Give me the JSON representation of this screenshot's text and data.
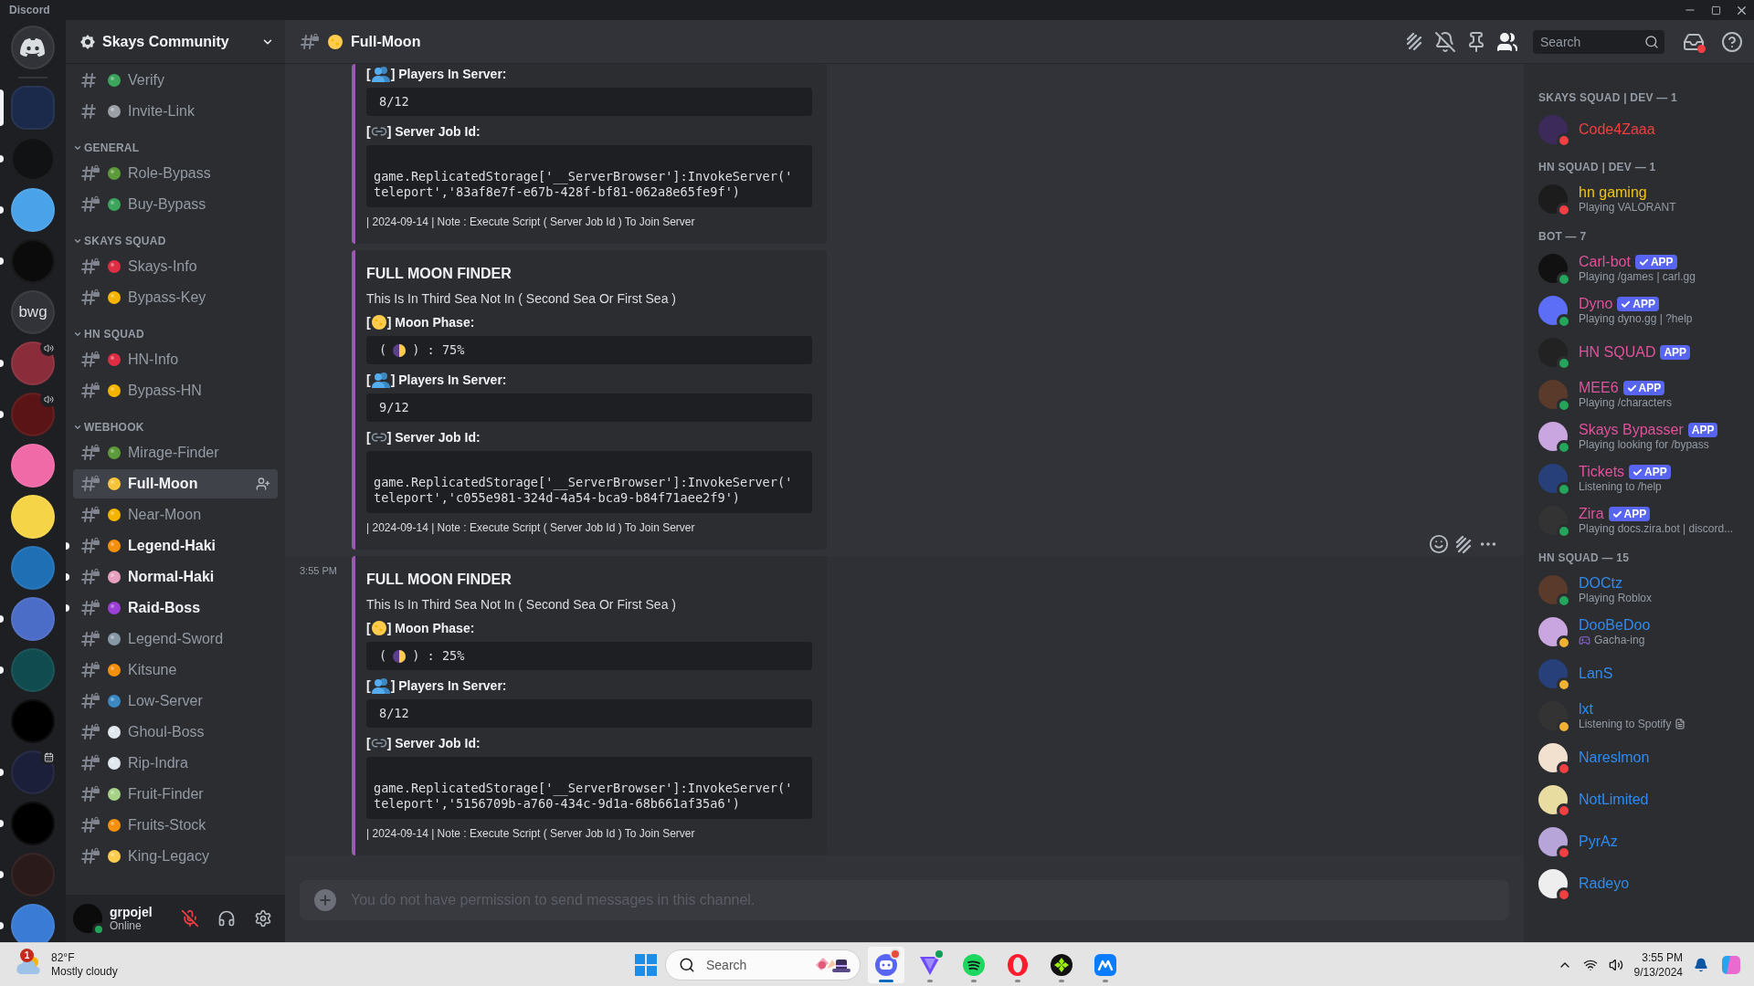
{
  "app_title": "Discord",
  "servers": [
    {
      "kind": "home",
      "selected": false,
      "unread": false
    },
    {
      "kind": "icon",
      "selected": true
    },
    {
      "kind": "icon",
      "selected": false,
      "unread": true
    },
    {
      "kind": "icon",
      "selected": false,
      "unread": true
    },
    {
      "kind": "icon",
      "selected": false,
      "unread": true
    },
    {
      "kind": "text",
      "label": "bwg",
      "selected": false,
      "unread": false
    },
    {
      "kind": "icon",
      "selected": false,
      "unread": true,
      "voice_active": true
    },
    {
      "kind": "icon",
      "selected": false,
      "unread": true,
      "voice_active": true
    },
    {
      "kind": "icon",
      "selected": false,
      "unread": false
    },
    {
      "kind": "icon",
      "selected": false,
      "unread": false
    },
    {
      "kind": "icon",
      "selected": false,
      "unread": false
    },
    {
      "kind": "icon",
      "selected": false,
      "unread": true
    },
    {
      "kind": "icon",
      "selected": false,
      "unread": true
    },
    {
      "kind": "icon",
      "selected": false,
      "unread": false
    },
    {
      "kind": "icon",
      "selected": false,
      "unread": true,
      "has_event": true
    },
    {
      "kind": "icon",
      "selected": false,
      "unread": true
    },
    {
      "kind": "icon",
      "selected": false,
      "unread": true
    },
    {
      "kind": "icon",
      "selected": false,
      "unread": true
    }
  ],
  "channel_sidebar": {
    "server_name": "Skays Community",
    "groups": [
      {
        "channels": [
          {
            "name": "Verify",
            "locked": false,
            "selected": false,
            "unread": false
          },
          {
            "name": "Invite-Link",
            "locked": false,
            "selected": false,
            "unread": false
          }
        ]
      },
      {
        "category": "GENERAL",
        "expanded": true,
        "channels": [
          {
            "name": "Role-Bypass",
            "locked": true,
            "selected": false,
            "unread": false
          },
          {
            "name": "Buy-Bypass",
            "locked": true,
            "selected": false,
            "unread": false
          }
        ]
      },
      {
        "category": "SKAYS SQUAD",
        "expanded": true,
        "channels": [
          {
            "name": "Skays-Info",
            "locked": true,
            "selected": false,
            "unread": false
          },
          {
            "name": "Bypass-Key",
            "locked": true,
            "selected": false,
            "unread": false
          }
        ]
      },
      {
        "category": "HN SQUAD",
        "expanded": true,
        "channels": [
          {
            "name": "HN-Info",
            "locked": true,
            "selected": false,
            "unread": false
          },
          {
            "name": "Bypass-HN",
            "locked": true,
            "selected": false,
            "unread": false
          }
        ]
      },
      {
        "category": "WEBHOOK",
        "expanded": true,
        "channels": [
          {
            "name": "Mirage-Finder",
            "locked": true,
            "selected": false,
            "unread": false
          },
          {
            "name": "Full-Moon",
            "locked": true,
            "selected": true,
            "unread": false
          },
          {
            "name": "Near-Moon",
            "locked": true,
            "selected": false,
            "unread": false
          },
          {
            "name": "Legend-Haki",
            "locked": true,
            "selected": false,
            "unread": true
          },
          {
            "name": "Normal-Haki",
            "locked": true,
            "selected": false,
            "unread": true
          },
          {
            "name": "Raid-Boss",
            "locked": true,
            "selected": false,
            "unread": true
          },
          {
            "name": "Legend-Sword",
            "locked": true,
            "selected": false,
            "unread": false
          },
          {
            "name": "Kitsune",
            "locked": true,
            "selected": false,
            "unread": false
          },
          {
            "name": "Low-Server",
            "locked": true,
            "selected": false,
            "unread": false
          },
          {
            "name": "Ghoul-Boss",
            "locked": true,
            "selected": false,
            "unread": false
          },
          {
            "name": "Rip-Indra",
            "locked": true,
            "selected": false,
            "unread": false
          },
          {
            "name": "Fruit-Finder",
            "locked": true,
            "selected": false,
            "unread": false
          },
          {
            "name": "Fruits-Stock",
            "locked": true,
            "selected": false,
            "unread": false
          },
          {
            "name": "King-Legacy",
            "locked": true,
            "selected": false,
            "unread": false
          }
        ]
      }
    ]
  },
  "user_panel": {
    "username": "grpojel",
    "status_text": "Online",
    "muted": true
  },
  "channel_header": {
    "name": "Full-Moon",
    "search_placeholder": "Search",
    "member_list_shown": true
  },
  "messages": [
    {
      "embed": {
        "fields": [
          {
            "kind": "players",
            "open": "[",
            "label": "] Players In Server:",
            "value": "8/12"
          },
          {
            "kind": "link",
            "open": "[",
            "label": "] Server Job Id:",
            "code": "game.ReplicatedStorage['__ServerBrowser']:InvokeServer('teleport','83af8e7f-e67b-428f-bf81-062a8e65fe9f')"
          }
        ],
        "footer": "| 2024-09-14 | Note : Execute Script ( Server Job Id ) To Join Server"
      }
    },
    {
      "embed": {
        "title": "FULL MOON FINDER",
        "description": "This Is In Third Sea Not In ( Second Sea Or First Sea )",
        "fields": [
          {
            "kind": "moon",
            "open": "[",
            "label": "] Moon Phase:",
            "value_open": "(",
            "value": ") : 75%"
          },
          {
            "kind": "players",
            "open": "[",
            "label": "] Players In Server:",
            "value": "9/12"
          },
          {
            "kind": "link",
            "open": "[",
            "label": "] Server Job Id:",
            "code": "game.ReplicatedStorage['__ServerBrowser']:InvokeServer('teleport','c055e981-324d-4a54-bca9-b84f71aee2f9')"
          }
        ],
        "footer": "| 2024-09-14 | Note : Execute Script ( Server Job Id ) To Join Server"
      }
    },
    {
      "timestamp": "3:55 PM",
      "hovered": true,
      "embed": {
        "title": "FULL MOON FINDER",
        "description": "This Is In Third Sea Not In ( Second Sea Or First Sea )",
        "fields": [
          {
            "kind": "moon",
            "open": "[",
            "label": "] Moon Phase:",
            "value_open": "(",
            "value": ") : 25%"
          },
          {
            "kind": "players",
            "open": "[",
            "label": "] Players In Server:",
            "value": "8/12"
          },
          {
            "kind": "link",
            "open": "[",
            "label": "] Server Job Id:",
            "code": "game.ReplicatedStorage['__ServerBrowser']:InvokeServer('teleport','5156709b-a760-434c-9d1a-68b661af35a6')"
          }
        ],
        "footer": "| 2024-09-14 | Note : Execute Script ( Server Job Id ) To Join Server"
      }
    }
  ],
  "message_input": {
    "placeholder": "You do not have permission to send messages in this channel."
  },
  "member_groups": [
    {
      "title": "SKAYS SQUAD | DEV — 1",
      "members": [
        {
          "name": "Code4Zaaa",
          "color": "#f23f42",
          "status": {
            "color": "#f23f42"
          }
        }
      ]
    },
    {
      "title": "HN SQUAD | DEV — 1",
      "members": [
        {
          "name": "hn gaming",
          "color": "#f1c40f",
          "status": {
            "color": "#f23f42"
          },
          "activity": "Playing VALORANT"
        }
      ]
    },
    {
      "title": "BOT — 7",
      "members": [
        {
          "name": "Carl-bot",
          "color": "#e0529c",
          "status": {
            "color": "#23a55a"
          },
          "tag": "APP",
          "verified": true,
          "activity": "Playing /games | carl.gg"
        },
        {
          "name": "Dyno",
          "color": "#e0529c",
          "status": {
            "color": "#23a55a"
          },
          "tag": "APP",
          "verified": true,
          "activity": "Playing dyno.gg | ?help"
        },
        {
          "name": "HN SQUAD",
          "color": "#e0529c",
          "status": {
            "color": "#23a55a"
          },
          "tag": "APP",
          "verified": false
        },
        {
          "name": "MEE6",
          "color": "#e0529c",
          "status": {
            "color": "#23a55a"
          },
          "tag": "APP",
          "verified": true,
          "activity": "Playing /characters"
        },
        {
          "name": "Skays Bypasser",
          "color": "#e0529c",
          "status": {
            "color": "#23a55a"
          },
          "tag": "APP",
          "verified": false,
          "activity": "Playing looking for /bypass"
        },
        {
          "name": "Tickets",
          "color": "#e0529c",
          "status": {
            "color": "#23a55a"
          },
          "tag": "APP",
          "verified": true,
          "activity": "Listening to /help"
        },
        {
          "name": "Zira",
          "color": "#e0529c",
          "status": {
            "color": "#23a55a"
          },
          "tag": "APP",
          "verified": true,
          "activity": "Playing docs.zira.bot | discord..."
        }
      ]
    },
    {
      "title": "HN SQUAD — 15",
      "members": [
        {
          "name": "DOCtz",
          "color": "#2f8bf0",
          "status": {
            "color": "#23a55a"
          },
          "activity": "Playing Roblox"
        },
        {
          "name": "DooBeDoo",
          "color": "#2f8bf0",
          "status": {
            "color": "#f0b232"
          },
          "activity": "Gacha-ing",
          "custom_status_icon": true
        },
        {
          "name": "LanS",
          "color": "#2f8bf0",
          "status": {
            "color": "#f0b232"
          }
        },
        {
          "name": "lxt",
          "color": "#2f8bf0",
          "status": {
            "color": "#f0b232"
          },
          "activity": "Listening to Spotify",
          "details_icon": true
        },
        {
          "name": "Nareslmon",
          "color": "#2f8bf0",
          "status": {
            "color": "#f23f42"
          }
        },
        {
          "name": "NotLimited",
          "color": "#2f8bf0",
          "status": {
            "color": "#f23f42"
          }
        },
        {
          "name": "PyrAz",
          "color": "#2f8bf0",
          "status": {
            "color": "#f23f42"
          }
        },
        {
          "name": "Radeyo",
          "color": "#2f8bf0",
          "status": {
            "color": "#f23f42"
          }
        }
      ]
    }
  ],
  "taskbar": {
    "weather": {
      "badge": "1",
      "temperature": "82°F",
      "condition": "Mostly cloudy"
    },
    "search_placeholder": "Search",
    "apps": [
      {
        "kind": "chat",
        "active": true,
        "notification": true
      },
      {
        "kind": "vpn",
        "active": false,
        "notification": true
      },
      {
        "kind": "music",
        "active": false,
        "notification": false
      },
      {
        "kind": "browser",
        "active": false,
        "notification": false
      },
      {
        "kind": "game",
        "active": false,
        "notification": false
      },
      {
        "kind": "notes",
        "active": false,
        "notification": false
      }
    ],
    "time": "3:55 PM",
    "date": "9/13/2024"
  }
}
